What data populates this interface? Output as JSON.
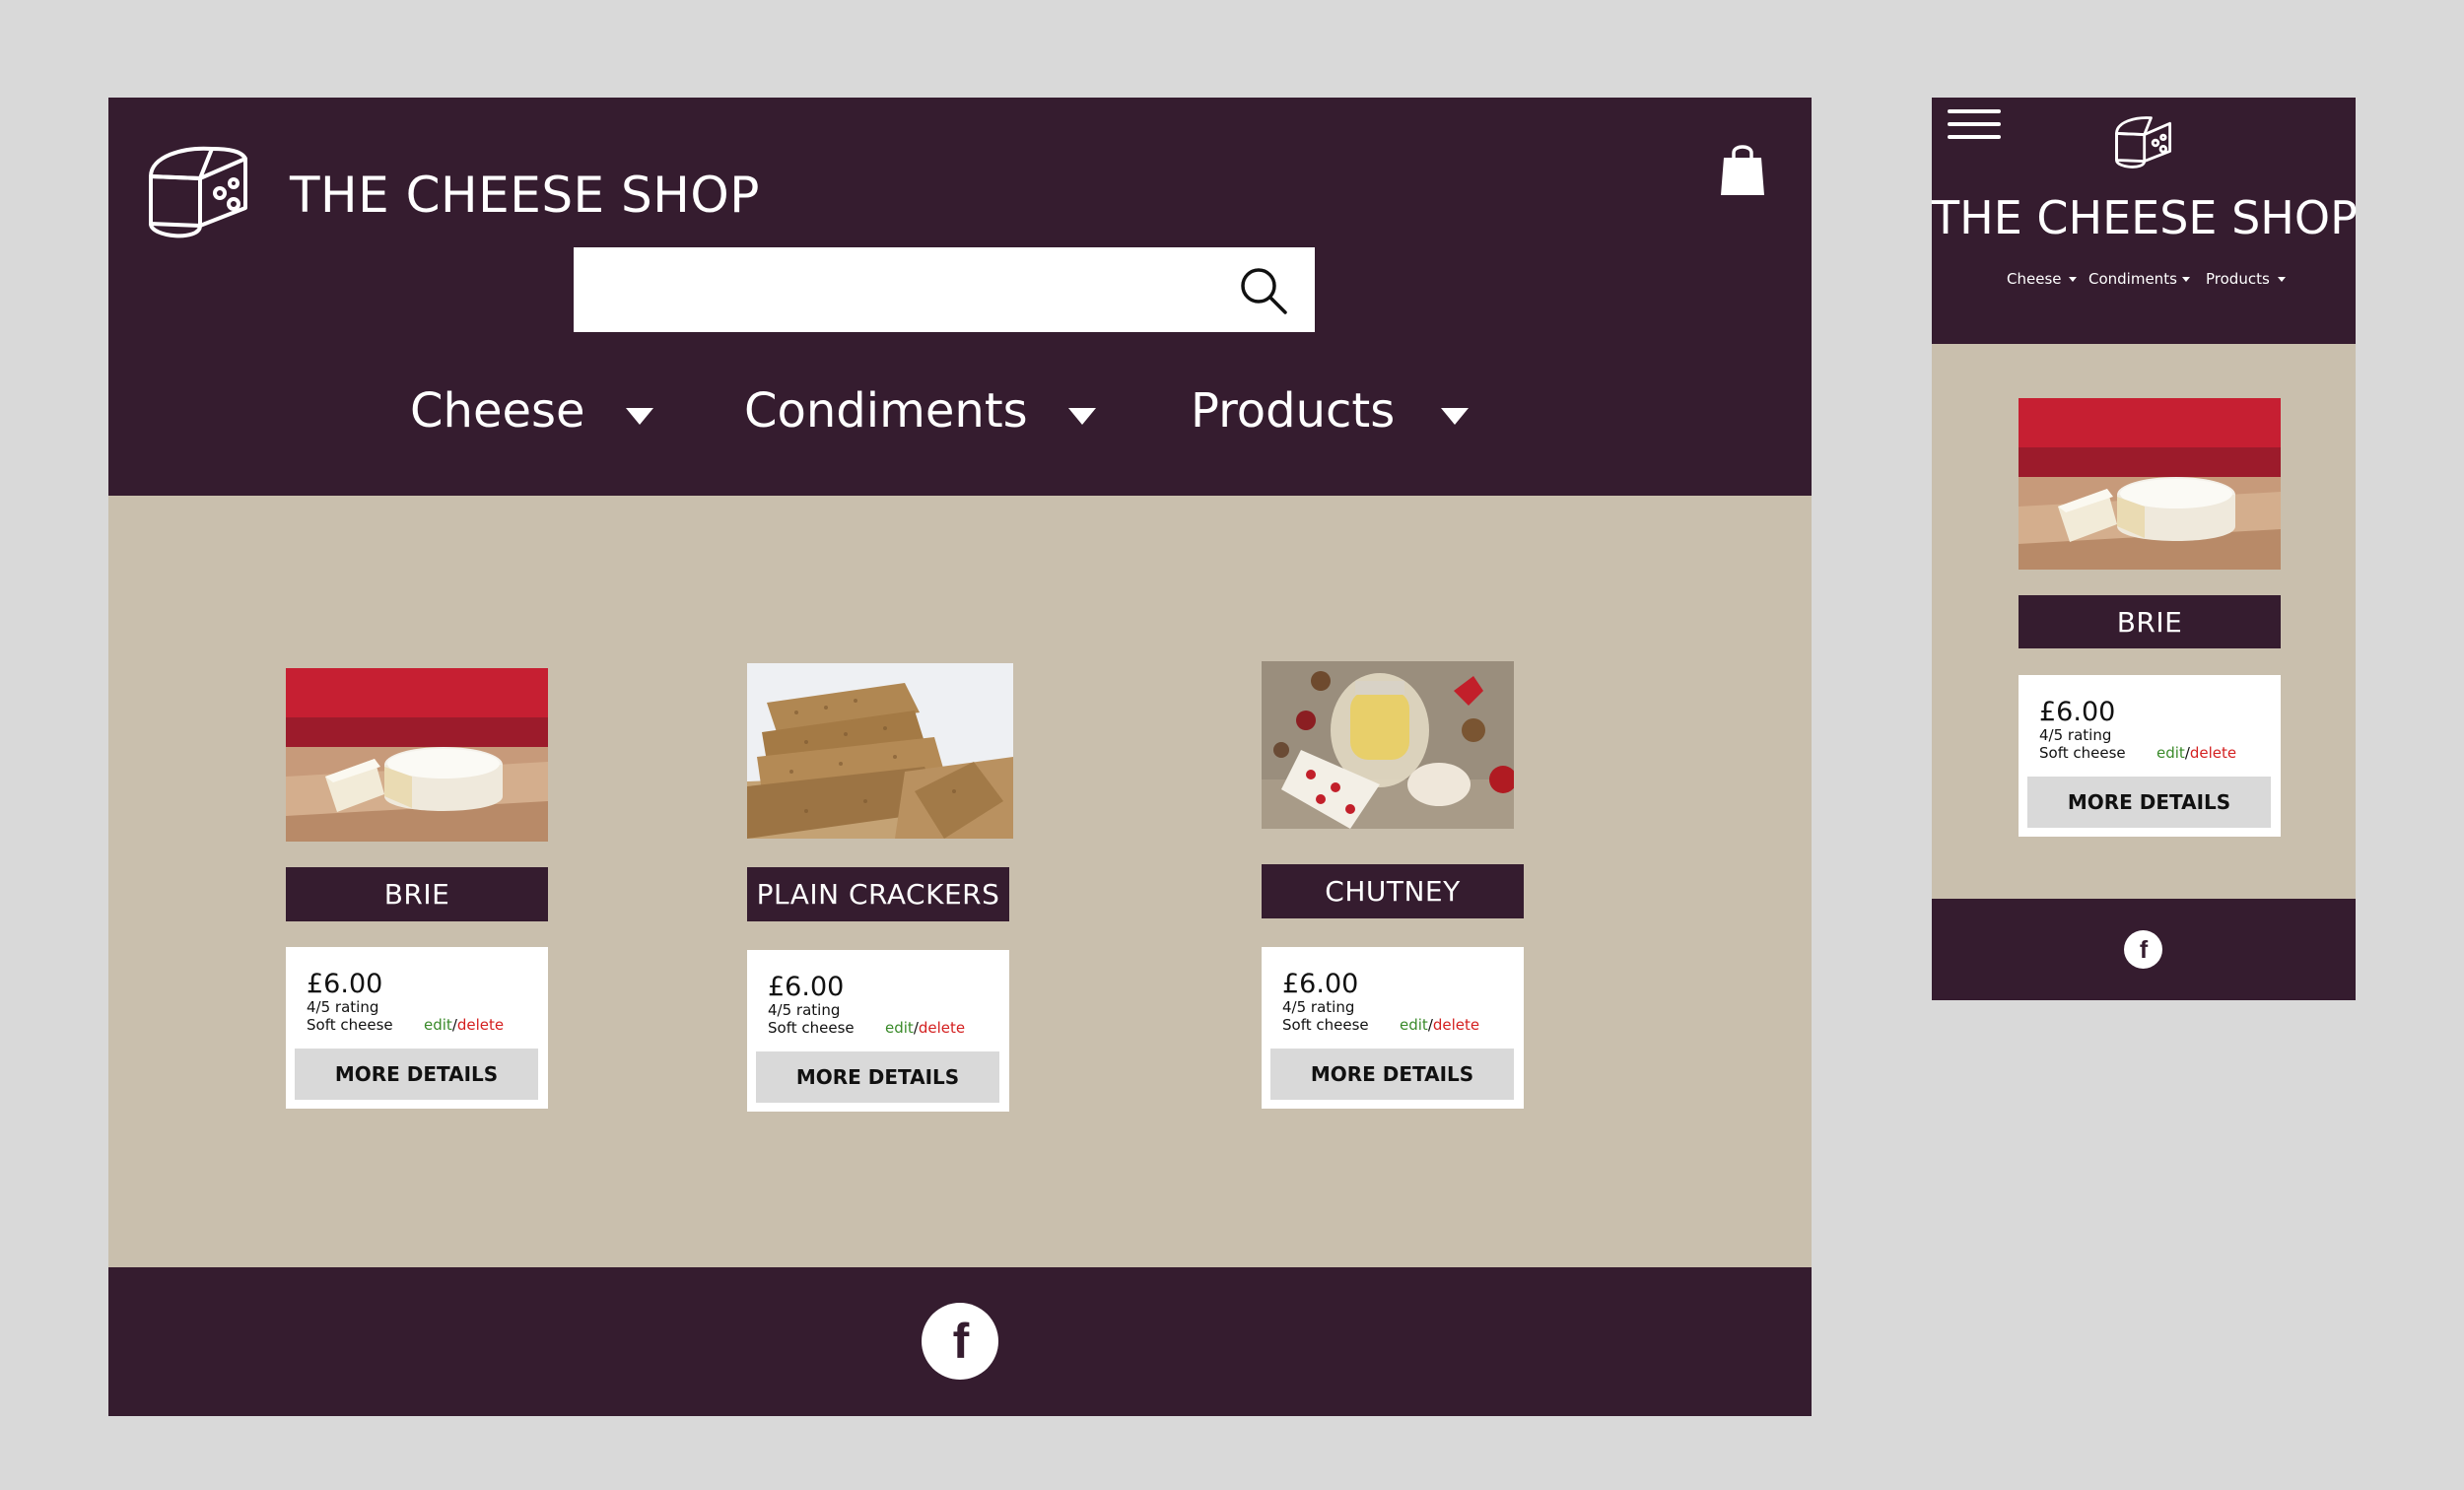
{
  "brand": {
    "title": "THE CHEESE SHOP",
    "color_primary": "#351c2f",
    "color_background": "#c9bfad"
  },
  "icons": {
    "logo": "cheese-wheel-icon",
    "cart": "shopping-bag-icon",
    "search": "search-icon",
    "menu": "hamburger-icon",
    "social": "facebook-icon",
    "dropdown": "caret-down-icon"
  },
  "nav": [
    {
      "label": "Cheese"
    },
    {
      "label": "Condiments"
    },
    {
      "label": "Products"
    }
  ],
  "search": {
    "value": "",
    "placeholder": ""
  },
  "products": [
    {
      "name": "BRIE",
      "price": "£6.00",
      "rating": "4/5 rating",
      "kind": "Soft cheese",
      "edit": "edit",
      "slash": "/",
      "delete": "delete",
      "more": "MORE DETAILS"
    },
    {
      "name": "PLAIN CRACKERS",
      "price": "£6.00",
      "rating": "4/5 rating",
      "kind": "Soft cheese",
      "edit": "edit",
      "slash": "/",
      "delete": "delete",
      "more": "MORE DETAILS"
    },
    {
      "name": "CHUTNEY",
      "price": "£6.00",
      "rating": "4/5 rating",
      "kind": "Soft cheese",
      "edit": "edit",
      "slash": "/",
      "delete": "delete",
      "more": "MORE DETAILS"
    }
  ],
  "mobile_product": {
    "name": "BRIE",
    "price": "£6.00",
    "rating": "4/5 rating",
    "kind": "Soft cheese",
    "edit": "edit",
    "slash": "/",
    "delete": "delete",
    "more": "MORE DETAILS"
  },
  "footer": {
    "social": "f"
  }
}
